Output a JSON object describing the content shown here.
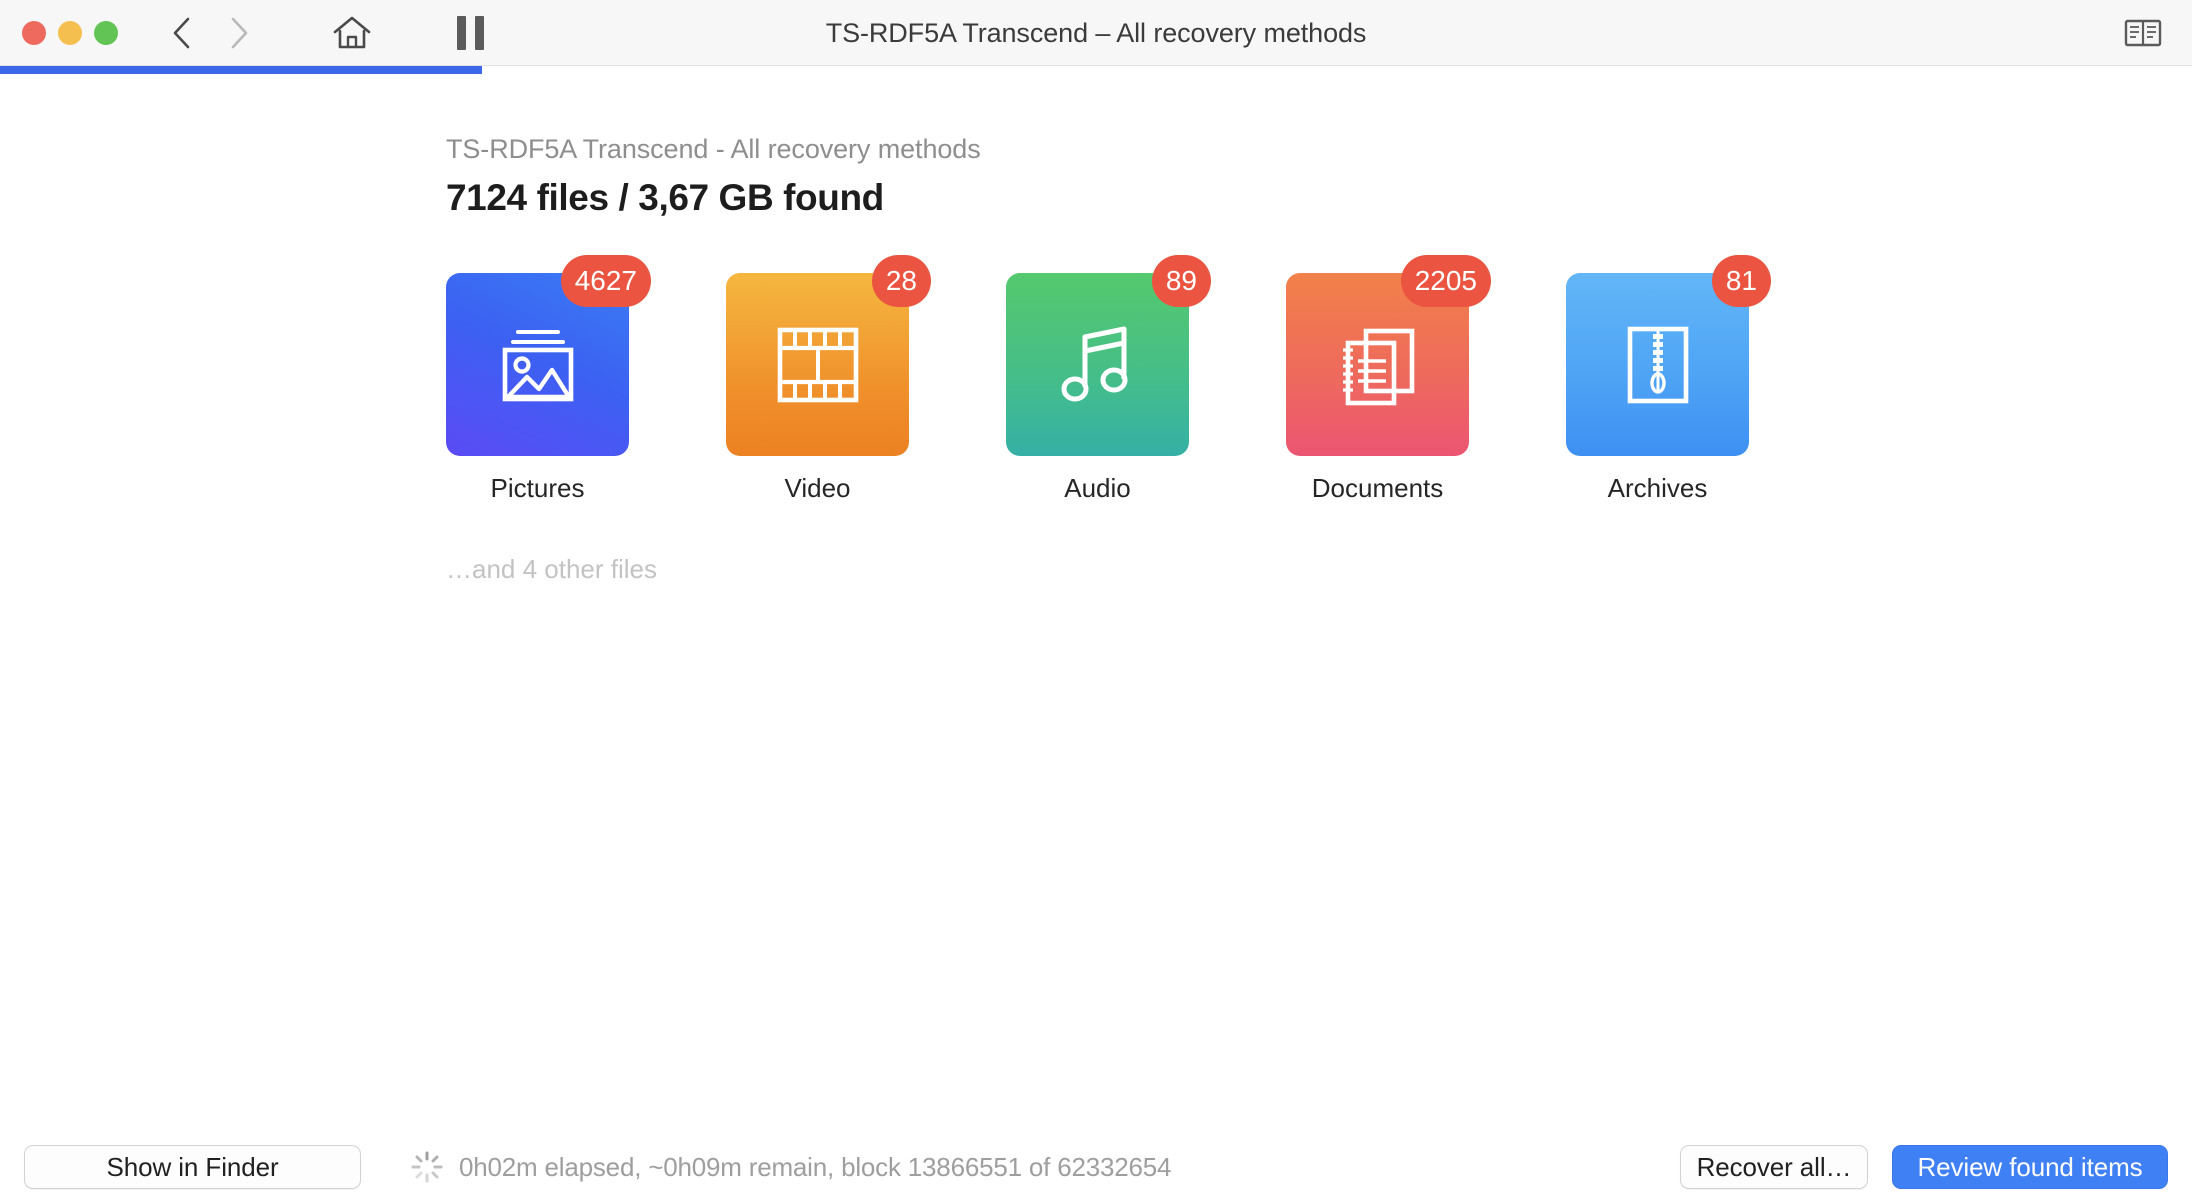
{
  "window": {
    "title": "TS-RDF5A Transcend – All recovery methods",
    "traffic_lights": [
      {
        "name": "close",
        "color": "#ee6a5f"
      },
      {
        "name": "minimize",
        "color": "#f5bf4f"
      },
      {
        "name": "zoom",
        "color": "#61c454"
      }
    ],
    "toolbar": {
      "back_icon": "chevron-left-icon",
      "forward_icon": "chevron-right-icon",
      "home_icon": "home-icon",
      "pause_icon": "pause-icon",
      "log_icon": "log-book-icon"
    }
  },
  "progress": {
    "percent": 22,
    "fill_color": "#3b68e8"
  },
  "main": {
    "subtitle": "TS-RDF5A Transcend - All recovery methods",
    "headline": "7124 files / 3,67 GB found",
    "other_files": "…and 4 other files",
    "categories": [
      {
        "label": "Pictures",
        "count": "4627",
        "icon": "image-icon",
        "badge_color": "#eb5440",
        "gradient_from": "#3b7cf5",
        "gradient_to": "#5b4bf5"
      },
      {
        "label": "Video",
        "count": "28",
        "icon": "film-strip-icon",
        "badge_color": "#eb5440",
        "gradient_from": "#f5b73f",
        "gradient_to": "#ec8122"
      },
      {
        "label": "Audio",
        "count": "89",
        "icon": "music-note-icon",
        "badge_color": "#eb5440",
        "gradient_from": "#55c96d",
        "gradient_to": "#35b0a6"
      },
      {
        "label": "Documents",
        "count": "2205",
        "icon": "documents-icon",
        "badge_color": "#eb5440",
        "gradient_from": "#f2814a",
        "gradient_to": "#ec5572"
      },
      {
        "label": "Archives",
        "count": "81",
        "icon": "zip-archive-icon",
        "badge_color": "#eb5440",
        "gradient_from": "#62b6f7",
        "gradient_to": "#3d90f2"
      }
    ]
  },
  "footer": {
    "show_in_finder": "Show in Finder",
    "status": "0h02m elapsed, ~0h09m remain, block 13866551 of 62332654",
    "status_icon": "spinner-icon",
    "recover_all": "Recover all…",
    "review_found": "Review found items",
    "primary_color": "#4080f5"
  }
}
